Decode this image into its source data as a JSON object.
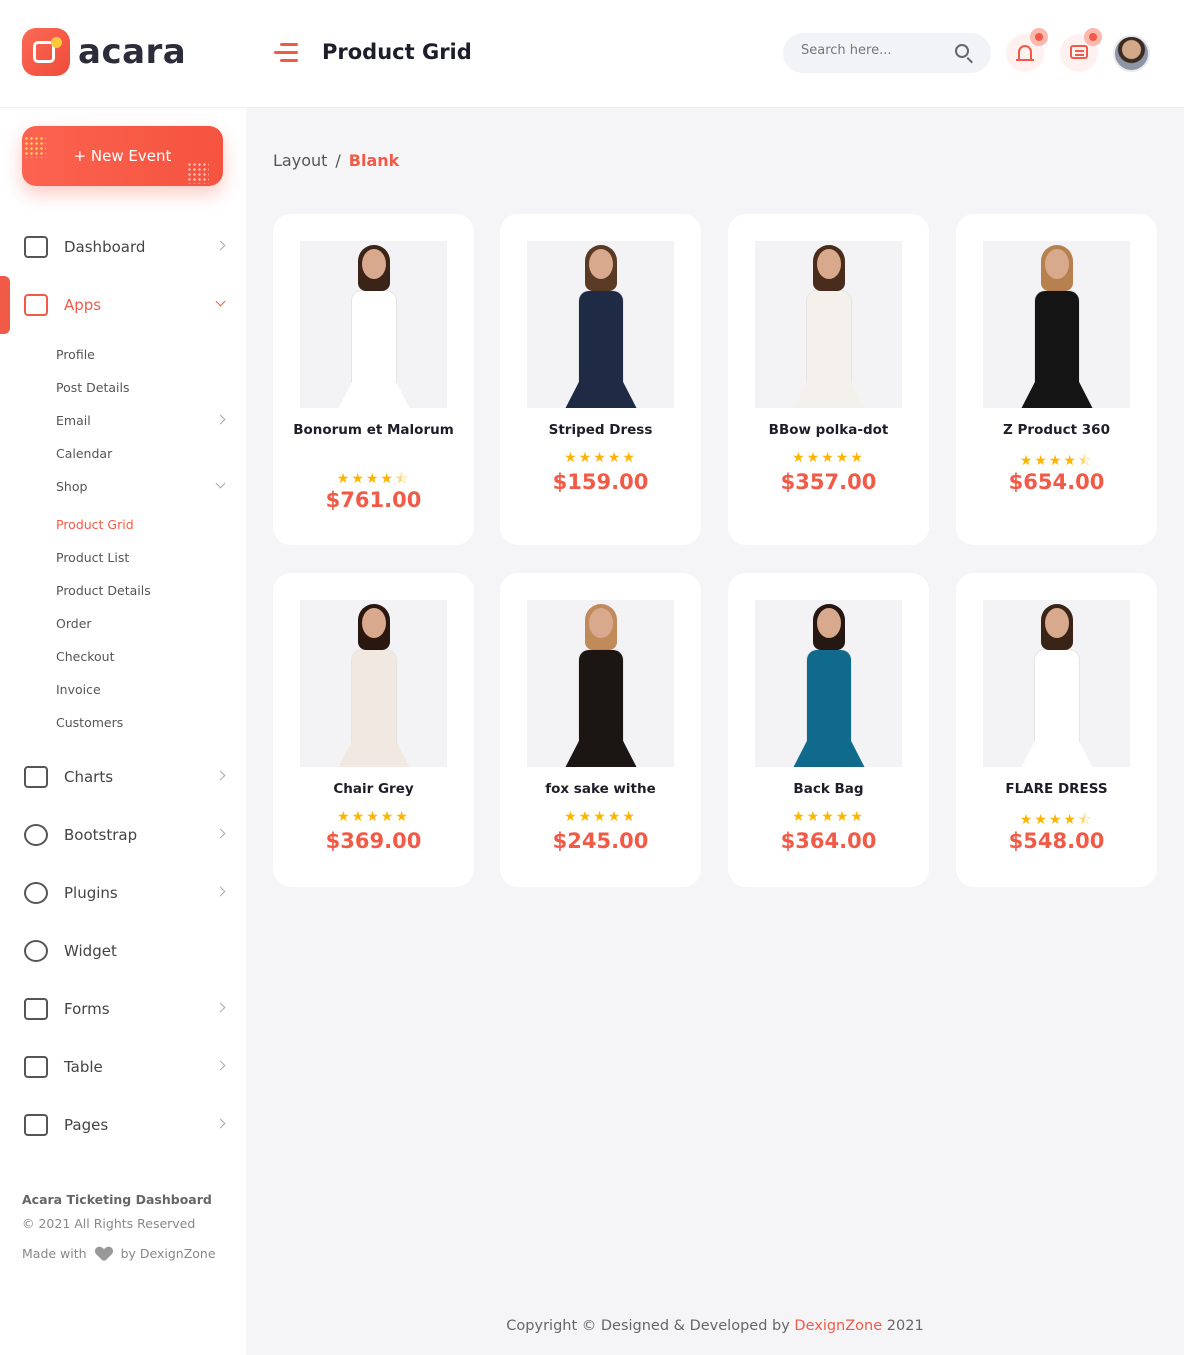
{
  "header": {
    "logo_text": "acara",
    "title": "Product Grid",
    "search_placeholder": "Search here...",
    "icons": [
      "menu-icon",
      "search-icon",
      "bell-icon",
      "chat-icon",
      "user-avatar"
    ]
  },
  "sidebar": {
    "new_event_label": "+ New Event",
    "items": [
      {
        "label": "Dashboard",
        "icon": "dashboard-icon"
      },
      {
        "label": "Apps",
        "icon": "monitor-icon",
        "active": true,
        "open": true
      },
      {
        "label": "Charts",
        "icon": "sliders-icon"
      },
      {
        "label": "Bootstrap",
        "icon": "globe-icon"
      },
      {
        "label": "Plugins",
        "icon": "heart-icon"
      },
      {
        "label": "Widget",
        "icon": "gear-icon"
      },
      {
        "label": "Forms",
        "icon": "clipboard-icon"
      },
      {
        "label": "Table",
        "icon": "table-icon"
      },
      {
        "label": "Pages",
        "icon": "layers-icon"
      }
    ],
    "apps_children": [
      "Profile",
      "Post Details",
      "Email",
      "Calendar",
      "Shop",
      "Product Grid",
      "Product List",
      "Product Details",
      "Order",
      "Checkout",
      "Invoice",
      "Customers"
    ],
    "footer_title": "Acara Ticketing Dashboard",
    "footer_copy": "© 2021 All Rights Reserved",
    "footer_made_prefix": "Made with",
    "footer_made_suffix": "by DexignZone"
  },
  "breadcrumb": {
    "parent": "Layout",
    "separator": "/",
    "current": "Blank"
  },
  "products": [
    {
      "name": "Bonorum et Malorum",
      "rating": 4.5,
      "stars": "★★★★",
      "half": "⯪",
      "price": "$761.00",
      "dress": "#ffffff",
      "hair": "#3a2418"
    },
    {
      "name": "Striped Dress",
      "rating": 5,
      "stars": "★★★★★",
      "half": "",
      "price": "$159.00",
      "dress": "#1f2b45",
      "hair": "#5a3a24"
    },
    {
      "name": "BBow polka-dot",
      "rating": 5,
      "stars": "★★★★★",
      "half": "",
      "price": "$357.00",
      "dress": "#f4f1ec",
      "hair": "#4a2c1c"
    },
    {
      "name": "Z Product 360",
      "rating": 4.5,
      "stars": "★★★★",
      "half": "⯪",
      "price": "$654.00",
      "dress": "#141414",
      "hair": "#b6804f"
    },
    {
      "name": "Chair Grey",
      "rating": 5,
      "stars": "★★★★★",
      "half": "",
      "price": "$369.00",
      "dress": "#f1e8e2",
      "hair": "#2a1810"
    },
    {
      "name": "fox sake withe",
      "rating": 5,
      "stars": "★★★★★",
      "half": "",
      "price": "$245.00",
      "dress": "#1b1514",
      "hair": "#c08a5a"
    },
    {
      "name": "Back Bag",
      "rating": 5,
      "stars": "★★★★★",
      "half": "",
      "price": "$364.00",
      "dress": "#0f6a8c",
      "hair": "#251712"
    },
    {
      "name": "FLARE DRESS",
      "rating": 4.5,
      "stars": "★★★★",
      "half": "⯪",
      "price": "$548.00",
      "dress": "#ffffff",
      "hair": "#3a2418"
    }
  ],
  "footer": {
    "prefix": "Copyright © Designed & Developed by ",
    "brand": "DexignZone",
    "year": " 2021"
  },
  "colors": {
    "accent": "#f25a48",
    "star": "#ffb400"
  }
}
